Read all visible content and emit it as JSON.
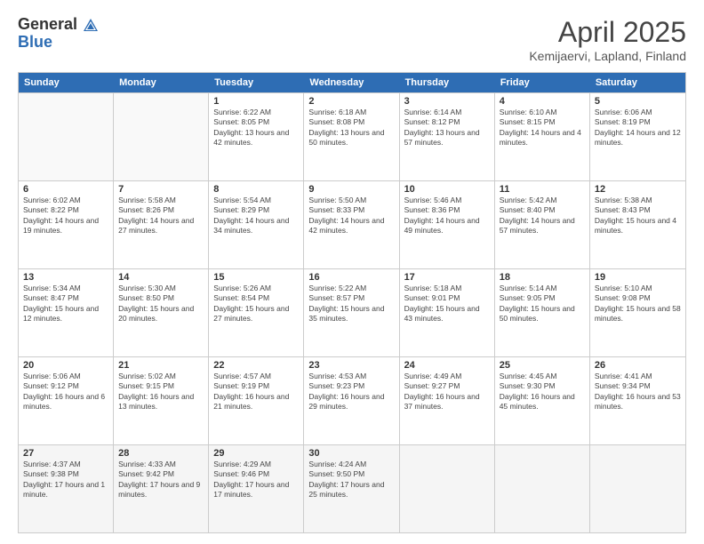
{
  "logo": {
    "general": "General",
    "blue": "Blue"
  },
  "title": "April 2025",
  "location": "Kemijaervi, Lapland, Finland",
  "header_days": [
    "Sunday",
    "Monday",
    "Tuesday",
    "Wednesday",
    "Thursday",
    "Friday",
    "Saturday"
  ],
  "weeks": [
    [
      {
        "day": "",
        "sunrise": "",
        "sunset": "",
        "daylight": ""
      },
      {
        "day": "",
        "sunrise": "",
        "sunset": "",
        "daylight": ""
      },
      {
        "day": "1",
        "sunrise": "Sunrise: 6:22 AM",
        "sunset": "Sunset: 8:05 PM",
        "daylight": "Daylight: 13 hours and 42 minutes."
      },
      {
        "day": "2",
        "sunrise": "Sunrise: 6:18 AM",
        "sunset": "Sunset: 8:08 PM",
        "daylight": "Daylight: 13 hours and 50 minutes."
      },
      {
        "day": "3",
        "sunrise": "Sunrise: 6:14 AM",
        "sunset": "Sunset: 8:12 PM",
        "daylight": "Daylight: 13 hours and 57 minutes."
      },
      {
        "day": "4",
        "sunrise": "Sunrise: 6:10 AM",
        "sunset": "Sunset: 8:15 PM",
        "daylight": "Daylight: 14 hours and 4 minutes."
      },
      {
        "day": "5",
        "sunrise": "Sunrise: 6:06 AM",
        "sunset": "Sunset: 8:19 PM",
        "daylight": "Daylight: 14 hours and 12 minutes."
      }
    ],
    [
      {
        "day": "6",
        "sunrise": "Sunrise: 6:02 AM",
        "sunset": "Sunset: 8:22 PM",
        "daylight": "Daylight: 14 hours and 19 minutes."
      },
      {
        "day": "7",
        "sunrise": "Sunrise: 5:58 AM",
        "sunset": "Sunset: 8:26 PM",
        "daylight": "Daylight: 14 hours and 27 minutes."
      },
      {
        "day": "8",
        "sunrise": "Sunrise: 5:54 AM",
        "sunset": "Sunset: 8:29 PM",
        "daylight": "Daylight: 14 hours and 34 minutes."
      },
      {
        "day": "9",
        "sunrise": "Sunrise: 5:50 AM",
        "sunset": "Sunset: 8:33 PM",
        "daylight": "Daylight: 14 hours and 42 minutes."
      },
      {
        "day": "10",
        "sunrise": "Sunrise: 5:46 AM",
        "sunset": "Sunset: 8:36 PM",
        "daylight": "Daylight: 14 hours and 49 minutes."
      },
      {
        "day": "11",
        "sunrise": "Sunrise: 5:42 AM",
        "sunset": "Sunset: 8:40 PM",
        "daylight": "Daylight: 14 hours and 57 minutes."
      },
      {
        "day": "12",
        "sunrise": "Sunrise: 5:38 AM",
        "sunset": "Sunset: 8:43 PM",
        "daylight": "Daylight: 15 hours and 4 minutes."
      }
    ],
    [
      {
        "day": "13",
        "sunrise": "Sunrise: 5:34 AM",
        "sunset": "Sunset: 8:47 PM",
        "daylight": "Daylight: 15 hours and 12 minutes."
      },
      {
        "day": "14",
        "sunrise": "Sunrise: 5:30 AM",
        "sunset": "Sunset: 8:50 PM",
        "daylight": "Daylight: 15 hours and 20 minutes."
      },
      {
        "day": "15",
        "sunrise": "Sunrise: 5:26 AM",
        "sunset": "Sunset: 8:54 PM",
        "daylight": "Daylight: 15 hours and 27 minutes."
      },
      {
        "day": "16",
        "sunrise": "Sunrise: 5:22 AM",
        "sunset": "Sunset: 8:57 PM",
        "daylight": "Daylight: 15 hours and 35 minutes."
      },
      {
        "day": "17",
        "sunrise": "Sunrise: 5:18 AM",
        "sunset": "Sunset: 9:01 PM",
        "daylight": "Daylight: 15 hours and 43 minutes."
      },
      {
        "day": "18",
        "sunrise": "Sunrise: 5:14 AM",
        "sunset": "Sunset: 9:05 PM",
        "daylight": "Daylight: 15 hours and 50 minutes."
      },
      {
        "day": "19",
        "sunrise": "Sunrise: 5:10 AM",
        "sunset": "Sunset: 9:08 PM",
        "daylight": "Daylight: 15 hours and 58 minutes."
      }
    ],
    [
      {
        "day": "20",
        "sunrise": "Sunrise: 5:06 AM",
        "sunset": "Sunset: 9:12 PM",
        "daylight": "Daylight: 16 hours and 6 minutes."
      },
      {
        "day": "21",
        "sunrise": "Sunrise: 5:02 AM",
        "sunset": "Sunset: 9:15 PM",
        "daylight": "Daylight: 16 hours and 13 minutes."
      },
      {
        "day": "22",
        "sunrise": "Sunrise: 4:57 AM",
        "sunset": "Sunset: 9:19 PM",
        "daylight": "Daylight: 16 hours and 21 minutes."
      },
      {
        "day": "23",
        "sunrise": "Sunrise: 4:53 AM",
        "sunset": "Sunset: 9:23 PM",
        "daylight": "Daylight: 16 hours and 29 minutes."
      },
      {
        "day": "24",
        "sunrise": "Sunrise: 4:49 AM",
        "sunset": "Sunset: 9:27 PM",
        "daylight": "Daylight: 16 hours and 37 minutes."
      },
      {
        "day": "25",
        "sunrise": "Sunrise: 4:45 AM",
        "sunset": "Sunset: 9:30 PM",
        "daylight": "Daylight: 16 hours and 45 minutes."
      },
      {
        "day": "26",
        "sunrise": "Sunrise: 4:41 AM",
        "sunset": "Sunset: 9:34 PM",
        "daylight": "Daylight: 16 hours and 53 minutes."
      }
    ],
    [
      {
        "day": "27",
        "sunrise": "Sunrise: 4:37 AM",
        "sunset": "Sunset: 9:38 PM",
        "daylight": "Daylight: 17 hours and 1 minute."
      },
      {
        "day": "28",
        "sunrise": "Sunrise: 4:33 AM",
        "sunset": "Sunset: 9:42 PM",
        "daylight": "Daylight: 17 hours and 9 minutes."
      },
      {
        "day": "29",
        "sunrise": "Sunrise: 4:29 AM",
        "sunset": "Sunset: 9:46 PM",
        "daylight": "Daylight: 17 hours and 17 minutes."
      },
      {
        "day": "30",
        "sunrise": "Sunrise: 4:24 AM",
        "sunset": "Sunset: 9:50 PM",
        "daylight": "Daylight: 17 hours and 25 minutes."
      },
      {
        "day": "",
        "sunrise": "",
        "sunset": "",
        "daylight": ""
      },
      {
        "day": "",
        "sunrise": "",
        "sunset": "",
        "daylight": ""
      },
      {
        "day": "",
        "sunrise": "",
        "sunset": "",
        "daylight": ""
      }
    ]
  ]
}
